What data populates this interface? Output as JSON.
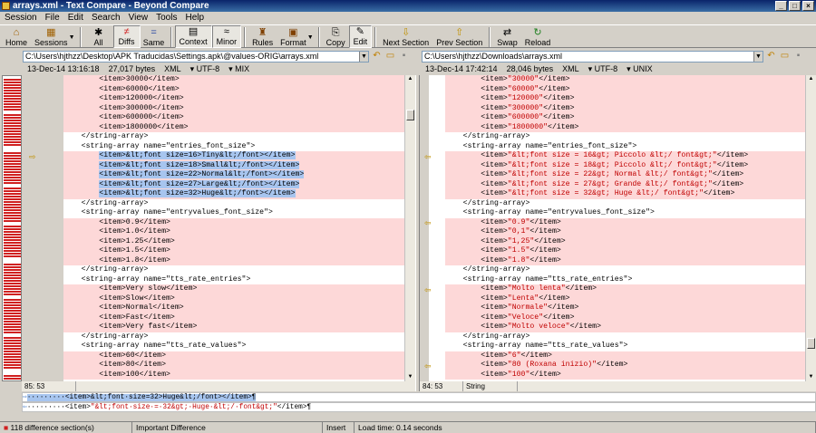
{
  "window": {
    "title": "arrays.xml - Text Compare - Beyond Compare"
  },
  "menu": [
    "Session",
    "File",
    "Edit",
    "Search",
    "View",
    "Tools",
    "Help"
  ],
  "toolbar": [
    {
      "label": "Home",
      "icon": "⌂"
    },
    {
      "label": "Sessions",
      "icon": "▦"
    },
    {
      "label": "All",
      "icon": "✱"
    },
    {
      "label": "Diffs",
      "icon": "≠"
    },
    {
      "label": "Same",
      "icon": "="
    },
    {
      "label": "Context",
      "icon": "▤"
    },
    {
      "label": "Minor",
      "icon": "≈"
    },
    {
      "label": "Rules",
      "icon": "♜"
    },
    {
      "label": "Format",
      "icon": "▣"
    },
    {
      "label": "Copy",
      "icon": "⎘"
    },
    {
      "label": "Edit",
      "icon": "✎"
    },
    {
      "label": "Next Section",
      "icon": "⇩"
    },
    {
      "label": "Prev Section",
      "icon": "⇧"
    },
    {
      "label": "Swap",
      "icon": "⇄"
    },
    {
      "label": "Reload",
      "icon": "↻"
    }
  ],
  "left": {
    "path": "C:\\Users\\hjthzz\\Desktop\\APK Traducidas\\Settings.apk\\@values-ORIG\\arrays.xml",
    "info": [
      "13-Dec-14 13:16:18",
      "27,017 bytes",
      "XML",
      "▾ UTF-8",
      "▾ MIX"
    ],
    "position": "85: 53",
    "lines": [
      "        <item>30000</item>",
      "        <item>60000</item>",
      "        <item>120000</item>",
      "        <item>300000</item>",
      "        <item>600000</item>",
      "        <item>1800000</item>",
      "    </string-array>",
      "    <string-array name=\"entries_font_size\">",
      "        <item>&lt;font size=16>Tiny&lt;/font></item>",
      "        <item>&lt;font size=18>Small&lt;/font></item>",
      "        <item>&lt;font size=22>Normal&lt;/font></item>",
      "        <item>&lt;font size=27>Large&lt;/font></item>",
      "        <item>&lt;font size=32>Huge&lt;/font></item>",
      "    </string-array>",
      "    <string-array name=\"entryvalues_font_size\">",
      "        <item>0.9</item>",
      "        <item>1.0</item>",
      "        <item>1.25</item>",
      "        <item>1.5</item>",
      "        <item>1.8</item>",
      "    </string-array>",
      "    <string-array name=\"tts_rate_entries\">",
      "        <item>Very slow</item>",
      "        <item>Slow</item>",
      "        <item>Normal</item>",
      "        <item>Fast</item>",
      "        <item>Very fast</item>",
      "    </string-array>",
      "    <string-array name=\"tts_rate_values\">",
      "        <item>60</item>",
      "        <item>80</item>",
      "        <item>100</item>"
    ]
  },
  "right": {
    "path": "C:\\Users\\hjthzz\\Downloads\\arrays.xml",
    "info": [
      "13-Dec-14 17:42:14",
      "28,046 bytes",
      "XML",
      "▾ UTF-8",
      "▾ UNIX"
    ],
    "position": "84: 53",
    "type": "String",
    "lines": [
      "        <item>\"30000\"</item>",
      "        <item>\"60000\"</item>",
      "        <item>\"120000\"</item>",
      "        <item>\"300000\"</item>",
      "        <item>\"600000\"</item>",
      "        <item>\"1800000\"</item>",
      "    </string-array>",
      "    <string-array name=\"entries_font_size\">",
      "        <item>\"&lt;font size = 16&gt; Piccolo &lt;/ font&gt;\"</item>",
      "        <item>\"&lt;font size = 18&gt; Piccolo &lt;/ font&gt;\"</item>",
      "        <item>\"&lt;font size = 22&gt; Normal &lt;/ font&gt;\"</item>",
      "        <item>\"&lt;font size = 27&gt; Grande &lt;/ font&gt;\"</item>",
      "        <item>\"&lt;font size = 32&gt; Huge &lt;/ font&gt;\"</item>",
      "    </string-array>",
      "    <string-array name=\"entryvalues_font_size\">",
      "        <item>\"0.9\"</item>",
      "        <item>\"0,1\"</item>",
      "        <item>\"1,25\"</item>",
      "        <item>\"1.5\"</item>",
      "        <item>\"1.8\"</item>",
      "    </string-array>",
      "    <string-array name=\"tts_rate_entries\">",
      "        <item>\"Molto lenta\"</item>",
      "        <item>\"Lenta\"</item>",
      "        <item>\"Normale\"</item>",
      "        <item>\"Veloce\"</item>",
      "        <item>\"Molto veloce\"</item>",
      "    </string-array>",
      "    <string-array name=\"tts_rate_values\">",
      "        <item>\"6\"</item>",
      "        <item>\"80 (Roxana inizio)\"</item>",
      "        <item>\"100\"</item>"
    ]
  },
  "compare": {
    "top": "·········<item>&lt;font·size=32>Huge&lt;/font></item>¶",
    "bottom": "·········<item>\"&lt;font·size·=·32&gt;·Huge·&lt;/·font&gt;\"</item>¶"
  },
  "status": {
    "sections": "118 difference section(s)",
    "importance": "Important Difference",
    "mode": "Insert",
    "load": "Load time: 0.14 seconds"
  },
  "colors": {
    "diff_bg": "#fdd8d8",
    "selection": "#a7c5ef",
    "changed_text": "#c00000"
  }
}
